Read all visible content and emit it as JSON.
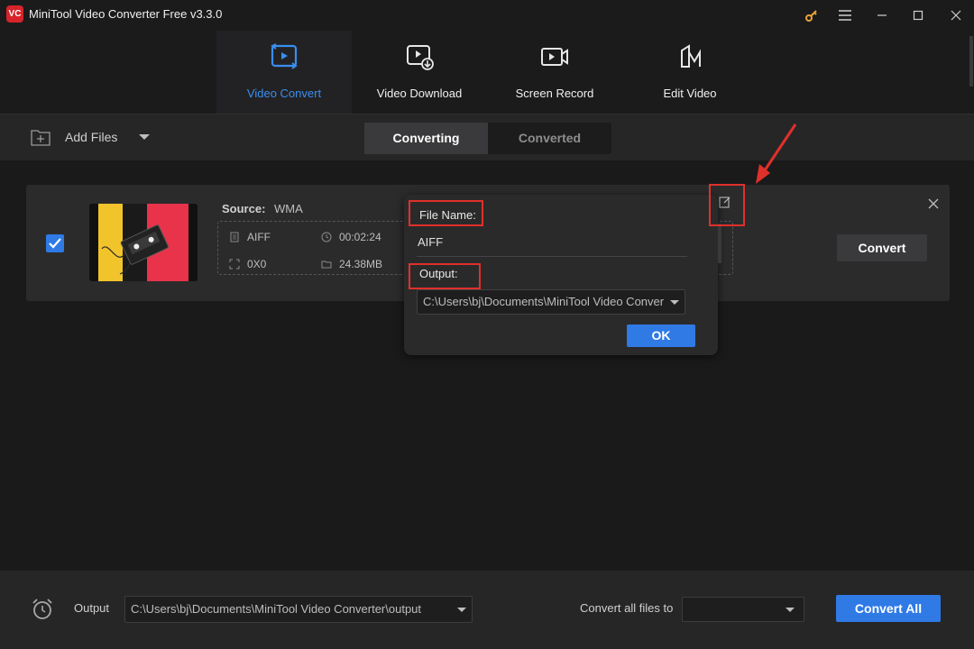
{
  "app": {
    "logo_text": "VC",
    "title": "MiniTool Video Converter Free v3.3.0"
  },
  "nav": {
    "tabs": [
      {
        "label": "Video Convert",
        "icon": "video-convert-icon",
        "active": true
      },
      {
        "label": "Video Download",
        "icon": "video-download-icon",
        "active": false
      },
      {
        "label": "Screen Record",
        "icon": "screen-record-icon",
        "active": false
      },
      {
        "label": "Edit Video",
        "icon": "edit-video-icon",
        "active": false
      }
    ]
  },
  "toolbar": {
    "add_files_label": "Add Files",
    "segments": [
      {
        "label": "Converting",
        "active": true
      },
      {
        "label": "Converted",
        "active": false
      }
    ]
  },
  "file": {
    "checked": true,
    "source_label": "Source:",
    "source_value": "WMA",
    "format": "AIFF",
    "duration": "00:02:24",
    "resolution": "0X0",
    "size": "24.38MB",
    "convert_label": "Convert"
  },
  "popup": {
    "file_name_label": "File Name:",
    "file_name_value": "AIFF",
    "output_label": "Output:",
    "output_value": "C:\\Users\\bj\\Documents\\MiniTool Video Conver",
    "ok_label": "OK"
  },
  "footer": {
    "output_label": "Output",
    "output_path": "C:\\Users\\bj\\Documents\\MiniTool Video Converter\\output",
    "convert_all_files_label": "Convert all files to",
    "convert_all_files_value": "",
    "convert_all_label": "Convert All"
  },
  "colors": {
    "accent": "#2f7ae5",
    "active_tab_text": "#3a8eef",
    "highlight": "#e0302a",
    "logo": "#d6242a",
    "key_icon": "#e8a23a"
  }
}
